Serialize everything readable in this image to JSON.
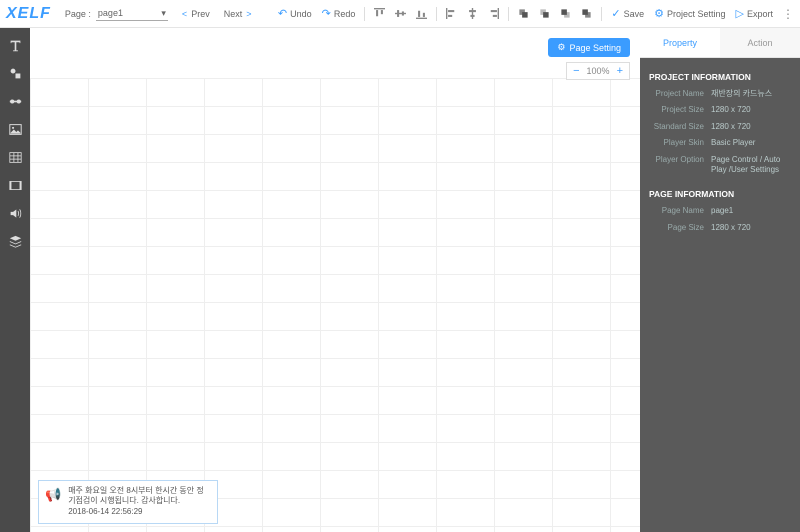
{
  "logo": "XELF",
  "page_label": "Page :",
  "page_current": "page1",
  "nav": {
    "prev": "Prev",
    "next": "Next"
  },
  "toolbar": {
    "undo": "Undo",
    "redo": "Redo",
    "save": "Save",
    "project_setting": "Project Setting",
    "export": "Export"
  },
  "page_setting_btn": "Page Setting",
  "zoom": {
    "value": "100%"
  },
  "tabs": {
    "property": "Property",
    "action": "Action"
  },
  "project_info": {
    "title": "PROJECT INFORMATION",
    "rows": [
      {
        "label": "Project Name",
        "value": "재반장의 카드뉴스"
      },
      {
        "label": "Project Size",
        "value": "1280 x 720"
      },
      {
        "label": "Standard Size",
        "value": "1280 x 720"
      },
      {
        "label": "Player Skin",
        "value": "Basic Player"
      },
      {
        "label": "Player Option",
        "value": "Page Control / Auto Play /User Settings"
      }
    ]
  },
  "page_info": {
    "title": "PAGE INFORMATION",
    "rows": [
      {
        "label": "Page Name",
        "value": "page1"
      },
      {
        "label": "Page Size",
        "value": "1280 x 720"
      }
    ]
  },
  "notice": {
    "text": "매주 화요일 오전 8시부터 한시간 동안 정기점검이 시행됩니다. 감사합니다.",
    "time": "2018-06-14 22:56:29"
  }
}
